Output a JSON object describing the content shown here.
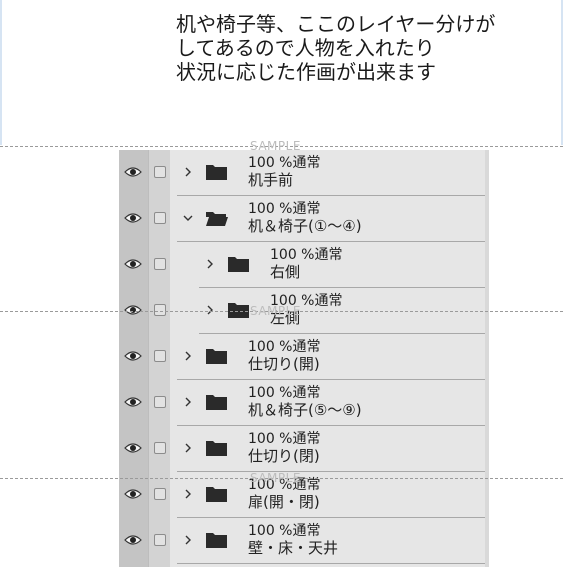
{
  "caption": {
    "line1": "机や椅子等、ここのレイヤー分けが",
    "line2": "してあるので人物を入れたり",
    "line3": "状況に応じた作画が出来ます"
  },
  "watermark": "SAMPLE",
  "layers": [
    {
      "mode": "100 %通常",
      "name": "机手前",
      "expanded": false,
      "indent": 0
    },
    {
      "mode": "100 %通常",
      "name": "机＆椅子(①～④)",
      "expanded": true,
      "indent": 0
    },
    {
      "mode": "100 %通常",
      "name": "右側",
      "expanded": false,
      "indent": 1
    },
    {
      "mode": "100 %通常",
      "name": "左側",
      "expanded": false,
      "indent": 1
    },
    {
      "mode": "100 %通常",
      "name": "仕切り(開)",
      "expanded": false,
      "indent": 0
    },
    {
      "mode": "100 %通常",
      "name": "机＆椅子(⑤～⑨)",
      "expanded": false,
      "indent": 0
    },
    {
      "mode": "100 %通常",
      "name": "仕切り(閉)",
      "expanded": false,
      "indent": 0
    },
    {
      "mode": "100 %通常",
      "name": "扉(開・閉)",
      "expanded": false,
      "indent": 0
    },
    {
      "mode": "100 %通常",
      "name": "壁・床・天井",
      "expanded": false,
      "indent": 0
    }
  ],
  "icons": {
    "visibility": "eye-icon",
    "lock": "checkbox-icon",
    "collapsed": "chevron-right-icon",
    "expanded": "chevron-down-icon",
    "folder": "folder-icon",
    "folder_open": "folder-open-icon"
  }
}
